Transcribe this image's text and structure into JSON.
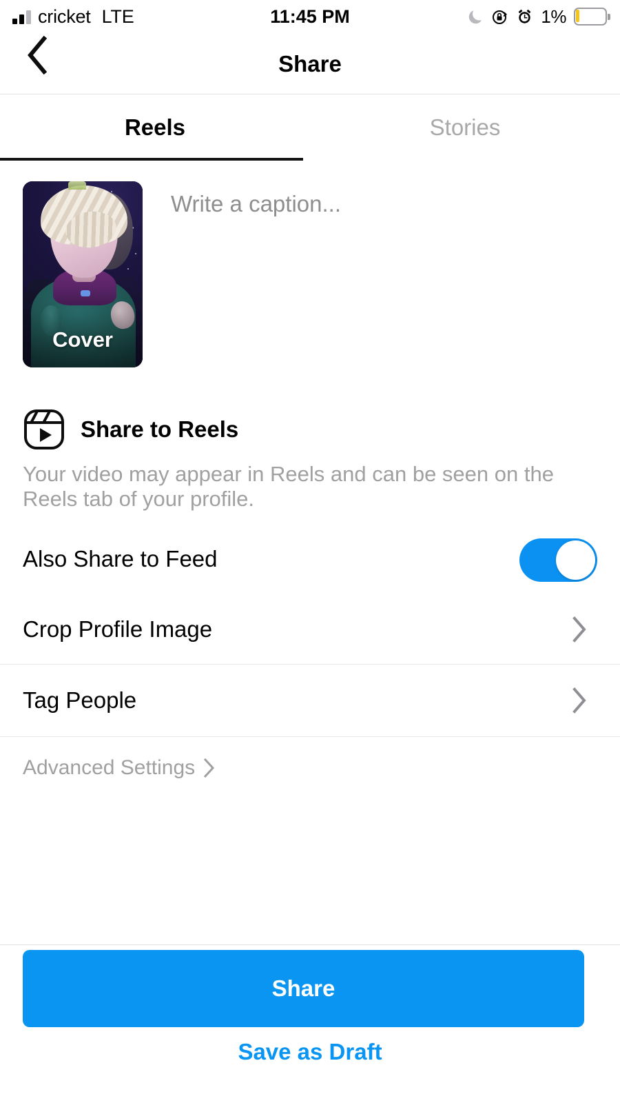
{
  "status_bar": {
    "carrier": "cricket",
    "network": "LTE",
    "time": "11:45 PM",
    "battery_percent": "1%",
    "icons": [
      "signal-bars-icon",
      "moon-icon",
      "rotation-lock-icon",
      "alarm-icon",
      "battery-icon"
    ]
  },
  "nav": {
    "back_icon": "chevron-left-icon",
    "title": "Share"
  },
  "tabs": [
    {
      "label": "Reels",
      "active": true
    },
    {
      "label": "Stories",
      "active": false
    }
  ],
  "composer": {
    "cover_label": "Cover",
    "caption_placeholder": "Write a caption..."
  },
  "share_to_reels": {
    "icon": "reels-icon",
    "title": "Share to Reels",
    "description": "Your video may appear in Reels and can be seen on the Reels tab of your profile."
  },
  "options": {
    "also_share_to_feed": {
      "label": "Also Share to Feed",
      "toggle_on": true
    },
    "crop_profile_image": {
      "label": "Crop Profile Image"
    },
    "tag_people": {
      "label": "Tag People"
    },
    "advanced_settings": {
      "label": "Advanced Settings"
    }
  },
  "footer": {
    "share_button": "Share",
    "save_draft_button": "Save as Draft"
  },
  "colors": {
    "accent_blue": "#0a95f2",
    "toggle_on": "#0a91f2",
    "muted_text": "#a0a0a0",
    "inactive_tab": "#a8a8a8",
    "battery_warning": "#f5c518"
  }
}
